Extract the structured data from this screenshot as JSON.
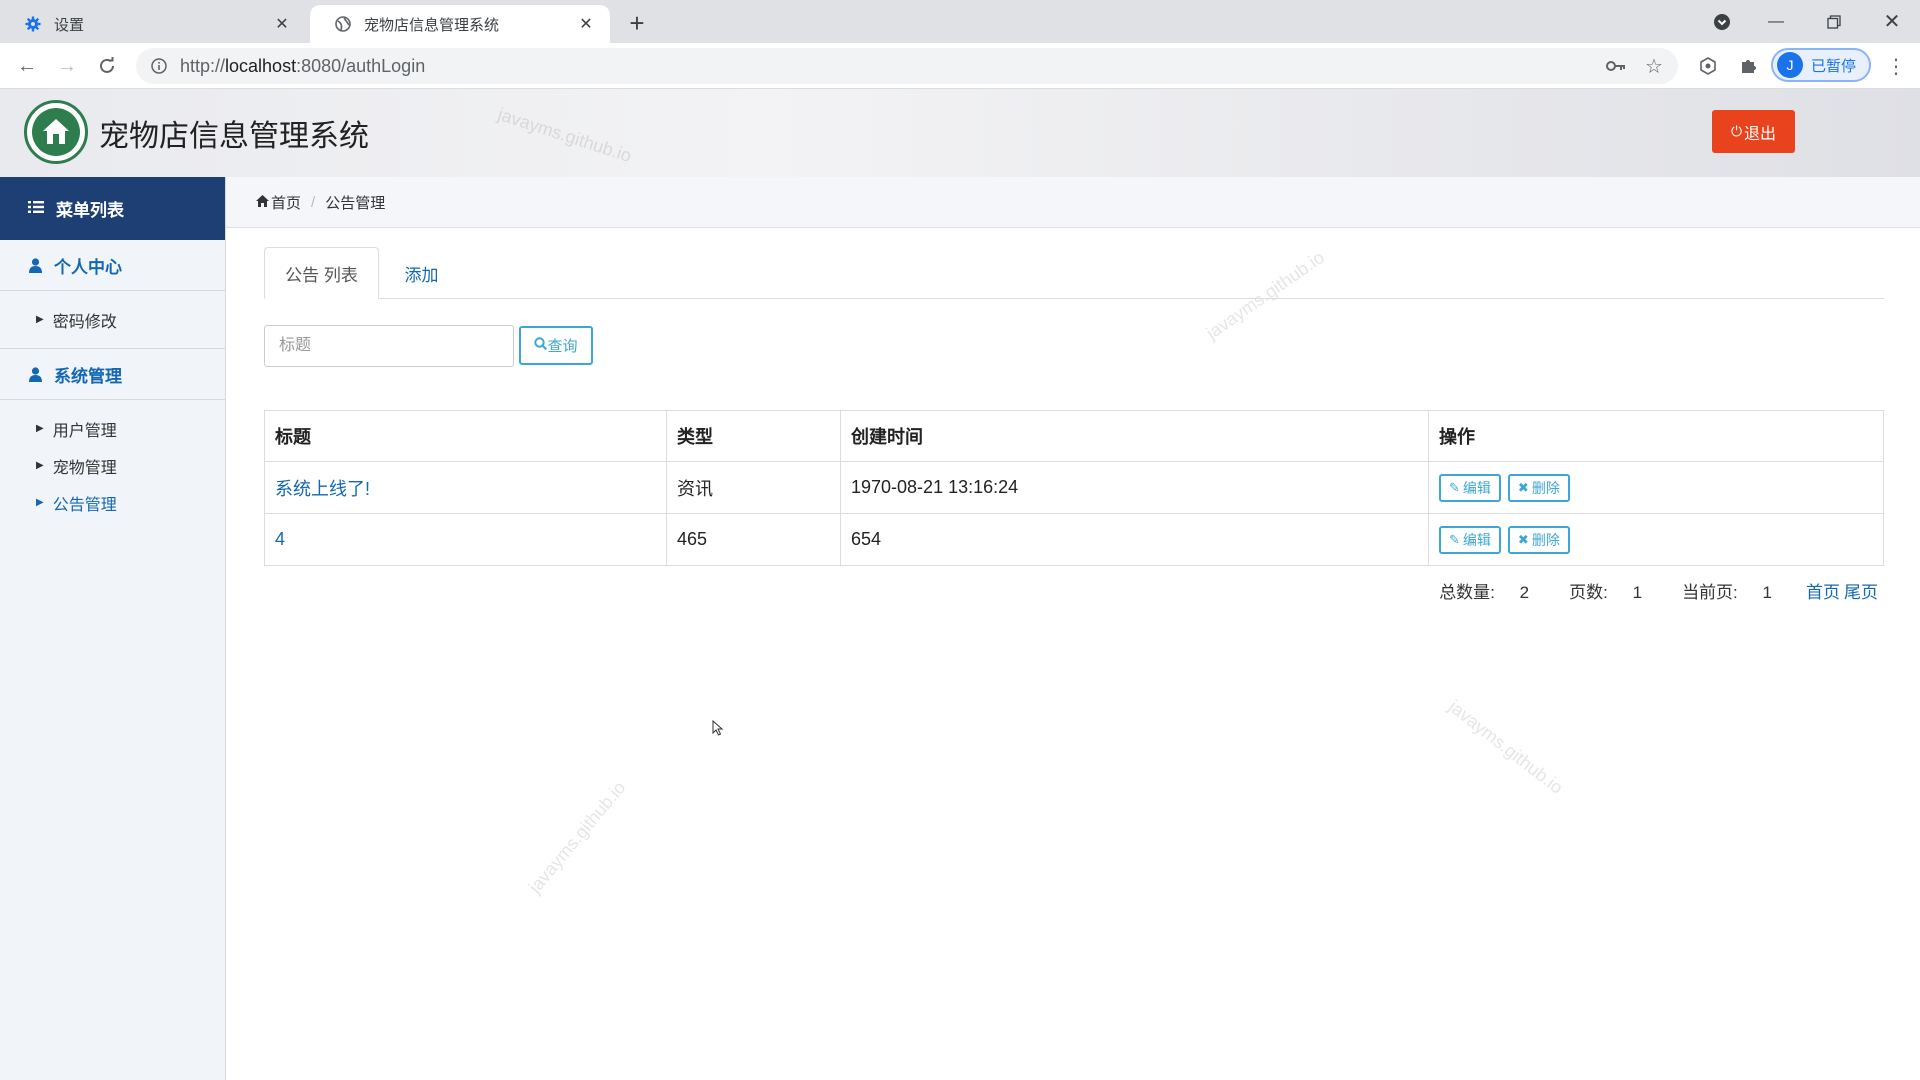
{
  "browser": {
    "tabs": [
      {
        "title": "设置",
        "icon": "gear-icon"
      },
      {
        "title": "宠物店信息管理系统",
        "icon": "globe-icon"
      }
    ],
    "url_scheme": "http://",
    "url_host": "localhost",
    "url_path": ":8080/authLogin",
    "profile_initial": "J",
    "profile_status": "已暂停"
  },
  "header": {
    "title": "宠物店信息管理系统",
    "logout_label": "退出",
    "watermark": "javayms.github.io"
  },
  "sidebar": {
    "title": "菜单列表",
    "groups": [
      {
        "label": "个人中心",
        "items": [
          {
            "label": "密码修改"
          }
        ]
      },
      {
        "label": "系统管理",
        "items": [
          {
            "label": "用户管理"
          },
          {
            "label": "宠物管理"
          },
          {
            "label": "公告管理"
          }
        ]
      }
    ]
  },
  "breadcrumb": {
    "home": "首页",
    "current": "公告管理"
  },
  "content": {
    "tabs": [
      {
        "label": "公告 列表"
      },
      {
        "label": "添加"
      }
    ],
    "search": {
      "placeholder": "标题",
      "value": "",
      "button": "查询"
    },
    "table": {
      "columns": [
        "标题",
        "类型",
        "创建时间",
        "操作"
      ],
      "rows": [
        {
          "title": "系统上线了!",
          "type": "资讯",
          "created": "1970-08-21 13:16:24",
          "edit": "编辑",
          "delete": "删除"
        },
        {
          "title": "4",
          "type": "465",
          "created": "654",
          "edit": "编辑",
          "delete": "删除"
        }
      ]
    },
    "pager": {
      "total_label": "总数量:",
      "total": "2",
      "pages_label": "页数:",
      "pages": "1",
      "current_label": "当前页:",
      "current": "1",
      "first": "首页",
      "last": "尾页"
    }
  },
  "colors": {
    "accent": "#1467b3",
    "danger": "#e8431c",
    "sidebar_head": "#1d3f73",
    "info": "#3da6d6"
  }
}
